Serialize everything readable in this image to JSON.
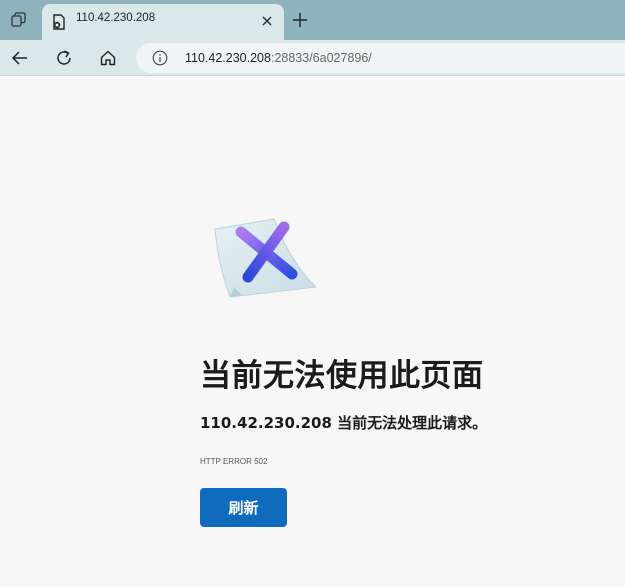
{
  "tab": {
    "title": "110.42.230.208"
  },
  "address_bar": {
    "host": "110.42.230.208",
    "path": ":28833/6a027896/"
  },
  "error_page": {
    "headline": "当前无法使用此页面",
    "message": "110.42.230.208 当前无法处理此请求。",
    "error_code": "HTTP ERROR 502",
    "refresh_label": "刷新"
  },
  "colors": {
    "tabbar_bg": "#8eb3bc",
    "toolbar_bg": "#dbe8ea",
    "page_bg": "#f7f7f7",
    "button_accent": "#0f6cbd"
  },
  "icons": [
    "tab-actions-icon",
    "broken-page-favicon-icon",
    "close-icon",
    "plus-icon",
    "back-arrow-icon",
    "refresh-icon",
    "home-icon",
    "info-icon",
    "error-x-illustration"
  ]
}
